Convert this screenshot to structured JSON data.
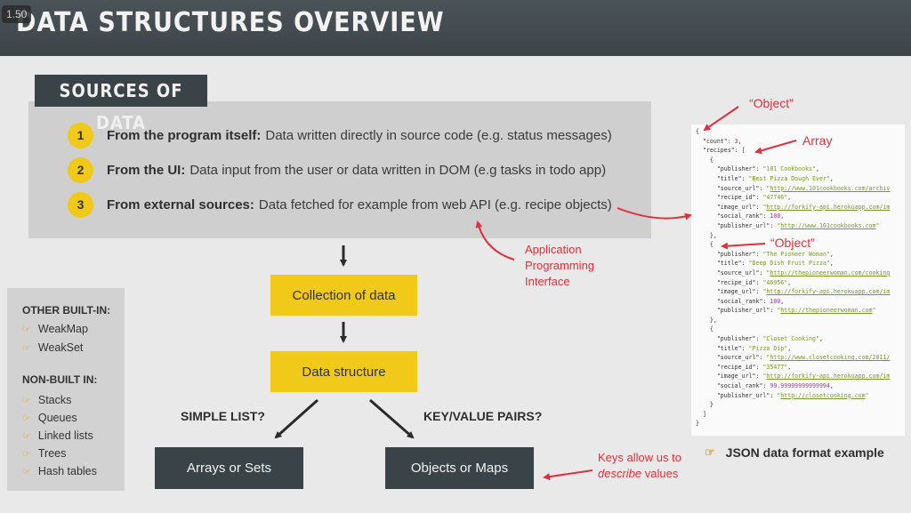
{
  "player": {
    "speed": "1.50"
  },
  "header": {
    "title": "DATA STRUCTURES OVERVIEW"
  },
  "sources": {
    "tag": "SOURCES OF DATA",
    "items": [
      {
        "num": "1",
        "bold": "From the program itself:",
        "text": "Data written directly in source code (e.g. status messages)"
      },
      {
        "num": "2",
        "bold": "From the UI:",
        "text": "Data input from the user or data written in DOM (e.g tasks in todo app)"
      },
      {
        "num": "3",
        "bold": "From external sources:",
        "text": "Data fetched for example from web API (e.g. recipe objects)"
      }
    ]
  },
  "flow": {
    "collection": "Collection of data",
    "structure": "Data structure",
    "simple_list": "SIMPLE LIST?",
    "key_value": "KEY/VALUE PAIRS?",
    "arrays": "Arrays or Sets",
    "objects": "Objects or Maps"
  },
  "sidebar": {
    "builtin_heading": "OTHER BUILT-IN:",
    "builtin": [
      "WeakMap",
      "WeakSet"
    ],
    "nonbuiltin_heading": "NON-BUILT IN:",
    "nonbuiltin": [
      "Stacks",
      "Queues",
      "Linked lists",
      "Trees",
      "Hash tables"
    ]
  },
  "annotations": {
    "object1": "“Object”",
    "array": "Array",
    "object2": "“Object”",
    "api_line1": "Application",
    "api_line2": "Programming",
    "api_line3": "Interface",
    "keys_line1": "Keys allow us to",
    "keys_em": "describe",
    "keys_rest": " values"
  },
  "json_example": {
    "caption": "JSON data format example",
    "count": "3",
    "recipes": [
      {
        "publisher": "101 Cookbooks",
        "title": "Best Pizza Dough Ever",
        "source_url": "http://www.101cookbooks.com/archiv",
        "recipe_id": "47746",
        "image_url": "http://forkify-api.herokuapp.com/im",
        "social_rank": "100",
        "publisher_url": "http://www.101cookbooks.com"
      },
      {
        "publisher": "The Pioneer Woman",
        "title": "Deep Dish Fruit Pizza",
        "source_url": "http://thepioneerwoman.com/cooking",
        "recipe_id": "46956",
        "image_url": "http://forkify-api.herokuapp.com/im",
        "social_rank": "100",
        "publisher_url": "http://thepioneerwoman.com"
      },
      {
        "publisher": "Closet Cooking",
        "title": "Pizza Dip",
        "source_url": "http://www.closetcooking.com/2011/",
        "recipe_id": "35477",
        "image_url": "http://forkify-api.herokuapp.com/im",
        "social_rank": "99.99999999999994",
        "publisher_url": "http://closetcooking.com"
      }
    ]
  },
  "colors": {
    "header": "#3d4549",
    "accent_yellow": "#f0c919",
    "annotation_red": "#e0303c",
    "dark_box": "#3a4347"
  },
  "icons": {
    "pointer": "hand-pointing-icon"
  }
}
